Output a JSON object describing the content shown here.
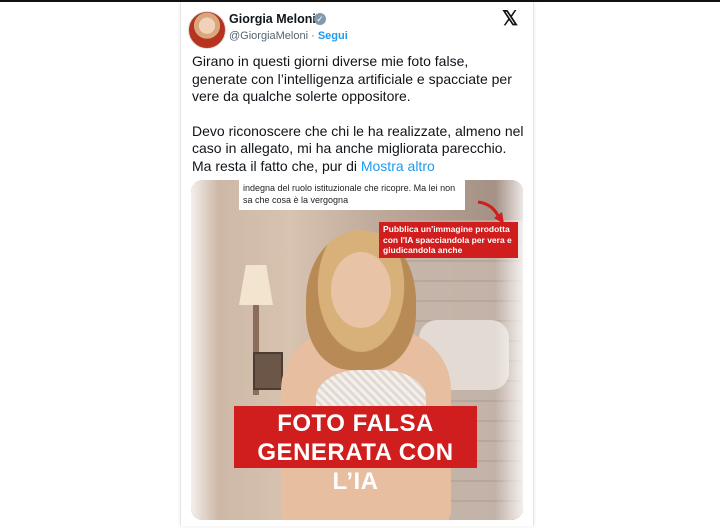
{
  "author": {
    "name": "Giorgia Meloni",
    "handle": "@GiorgiaMeloni",
    "separator": "·",
    "follow_label": "Segui"
  },
  "platform_logo": "𝕏",
  "icons": {
    "verified": "verified-badge-icon",
    "logo": "x-logo-icon"
  },
  "tweet": {
    "paragraph1": "Girano in questi giorni diverse mie foto false, generate con l’intelligenza artificiale e spacciate per vere da qualche solerte oppositore.",
    "paragraph2": "Devo riconoscere che chi le ha realizzate, almeno nel caso in allegato, mi ha anche migliorata parecchio. Ma resta il fatto che, pur di",
    "show_more": "Mostra altro"
  },
  "media": {
    "quote_text": "indegna del ruolo istituzionale che ricopre. Ma lei non sa che cosa è la vergogna",
    "callout_text": "Pubblica un'immagine prodotta con l'IA spacciandola per vera e giudicandola anche",
    "banner_line1": "FOTO FALSA",
    "banner_line2": "GENERATA CON L’IA"
  },
  "colors": {
    "link": "#1d9bf0",
    "red_banner": "#d01d1d",
    "verified": "#829aab"
  }
}
